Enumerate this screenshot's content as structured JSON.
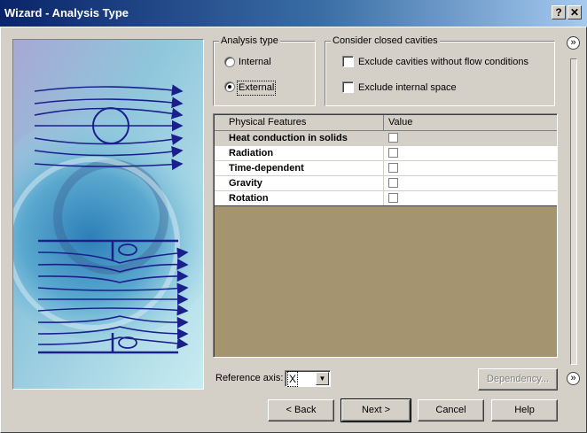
{
  "window": {
    "title": "Wizard - Analysis Type",
    "help_button": "?",
    "close_button": "✕"
  },
  "analysis_type": {
    "title": "Analysis type",
    "options": [
      {
        "label": "Internal",
        "checked": false
      },
      {
        "label": "External",
        "checked": true
      }
    ]
  },
  "closed_cavities": {
    "title": "Consider closed cavities",
    "options": [
      {
        "label": "Exclude cavities without flow conditions",
        "checked": false
      },
      {
        "label": "Exclude internal space",
        "checked": false
      }
    ]
  },
  "features_table": {
    "columns": [
      "Physical Features",
      "Value"
    ],
    "rows": [
      {
        "name": "Heat conduction in solids",
        "checked": false
      },
      {
        "name": "Radiation",
        "checked": false
      },
      {
        "name": "Time-dependent",
        "checked": false
      },
      {
        "name": "Gravity",
        "checked": false
      },
      {
        "name": "Rotation",
        "checked": false
      }
    ]
  },
  "reference_axis": {
    "label": "Reference axis:",
    "value": "X"
  },
  "buttons": {
    "dependency": "Dependency...",
    "back": "< Back",
    "next": "Next >",
    "cancel": "Cancel",
    "help": "Help"
  },
  "side_controls": {
    "top_expand": "»",
    "bottom_expand": "»"
  }
}
